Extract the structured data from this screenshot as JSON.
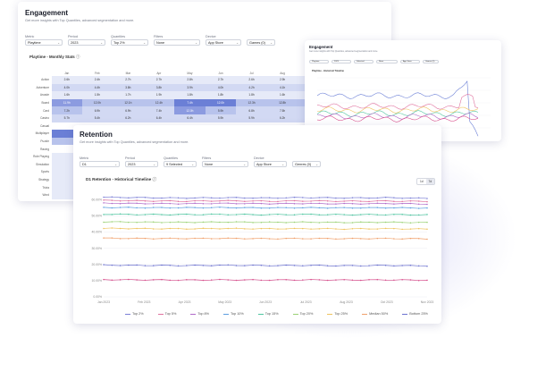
{
  "engagement": {
    "title": "Engagement",
    "subtitle": "Get more insights with Top Quantiles, advanced segmentation and more.",
    "filters": [
      {
        "label": "Metric",
        "value": "Playtime"
      },
      {
        "label": "Period",
        "value": "2023"
      },
      {
        "label": "Quantiles",
        "value": "Top 2%"
      },
      {
        "label": "Filters",
        "value": "None"
      },
      {
        "label": "Device",
        "value": "App Store"
      },
      {
        "label": "",
        "value": "Games (0)"
      }
    ],
    "table_title": "Playtime - Monthly Stats",
    "months": [
      "Jan",
      "Feb",
      "Mar",
      "Apr",
      "May",
      "Jun",
      "Jul",
      "Aug",
      "Sep"
    ],
    "rows": [
      {
        "genre": "Action",
        "cells": [
          "2.6h",
          "2.4h",
          "2.7h",
          "2.7h",
          "2.8h",
          "2.7h",
          "2.6h",
          "2.9h",
          "2.7h"
        ]
      },
      {
        "genre": "Adventure",
        "cells": [
          "4.0h",
          "4.4h",
          "3.8h",
          "3.8h",
          "3.9h",
          "4.0h",
          "4.2h",
          "4.1h",
          "4.0h"
        ]
      },
      {
        "genre": "Arcade",
        "cells": [
          "1.6h",
          "1.5h",
          "1.7h",
          "1.9h",
          "1.8h",
          "1.8h",
          "1.8h",
          "1.6h",
          "1.7h"
        ]
      },
      {
        "genre": "Board",
        "cells": [
          "11.9h",
          "12.0h",
          "12.1h",
          "12.4h",
          "7.4h",
          "12.0h",
          "12.3h",
          "12.8h",
          "12.4h"
        ]
      },
      {
        "genre": "Card",
        "cells": [
          "7.2h",
          "6.9h",
          "6.9h",
          "7.4h",
          "12.0h",
          "5.9h",
          "6.8h",
          "7.5h",
          "7.4h"
        ]
      },
      {
        "genre": "Casino",
        "cells": [
          "5.7h",
          "5.4h",
          "6.2h",
          "6.4h",
          "6.4h",
          "5.9h",
          "5.9h",
          "6.2h",
          "6.7h"
        ]
      },
      {
        "genre": "Casual",
        "cells": [
          "",
          "",
          "",
          "",
          "",
          "",
          "",
          "",
          ""
        ]
      },
      {
        "genre": "Multiplayer",
        "cells": [
          "",
          "",
          "",
          "",
          "",
          "",
          "",
          "",
          ""
        ]
      },
      {
        "genre": "Puzzle",
        "cells": [
          "",
          "",
          "",
          "",
          "",
          "",
          "",
          "",
          ""
        ]
      },
      {
        "genre": "Racing",
        "cells": [
          "",
          "",
          "",
          "",
          "",
          "",
          "",
          "",
          ""
        ]
      },
      {
        "genre": "Role Playing",
        "cells": [
          "",
          "",
          "",
          "",
          "",
          "",
          "",
          "",
          ""
        ]
      },
      {
        "genre": "Simulation",
        "cells": [
          "",
          "",
          "",
          "",
          "",
          "",
          "",
          "",
          ""
        ]
      },
      {
        "genre": "Sports",
        "cells": [
          "",
          "",
          "",
          "",
          "",
          "",
          "",
          "",
          ""
        ]
      },
      {
        "genre": "Strategy",
        "cells": [
          "",
          "",
          "",
          "",
          "",
          "",
          "",
          "",
          ""
        ]
      },
      {
        "genre": "Trivia",
        "cells": [
          "",
          "",
          "",
          "",
          "",
          "",
          "",
          "",
          ""
        ]
      },
      {
        "genre": "Word",
        "cells": [
          "",
          "",
          "",
          "",
          "",
          "",
          "",
          "",
          ""
        ]
      }
    ],
    "heat_levels": [
      [
        1,
        1,
        1,
        1,
        1,
        1,
        1,
        1,
        1
      ],
      [
        2,
        2,
        2,
        2,
        2,
        2,
        2,
        2,
        2
      ],
      [
        1,
        1,
        1,
        1,
        1,
        1,
        1,
        1,
        1
      ],
      [
        4,
        3,
        3,
        3,
        5,
        5,
        3,
        3,
        3
      ],
      [
        3,
        2,
        2,
        2,
        4,
        3,
        2,
        2,
        2
      ],
      [
        2,
        2,
        2,
        2,
        2,
        2,
        2,
        2,
        2
      ],
      [
        0,
        0,
        0,
        0,
        0,
        0,
        0,
        0,
        0
      ],
      [
        5,
        0,
        0,
        0,
        0,
        0,
        0,
        0,
        0
      ],
      [
        3,
        0,
        0,
        0,
        0,
        0,
        0,
        0,
        0
      ],
      [
        0,
        0,
        0,
        0,
        0,
        0,
        0,
        0,
        0
      ],
      [
        1,
        0,
        0,
        0,
        0,
        0,
        0,
        0,
        0
      ],
      [
        1,
        0,
        0,
        0,
        0,
        0,
        0,
        0,
        0
      ],
      [
        1,
        0,
        0,
        0,
        0,
        0,
        0,
        0,
        0
      ],
      [
        1,
        0,
        0,
        0,
        0,
        0,
        0,
        0,
        0
      ],
      [
        1,
        0,
        0,
        0,
        0,
        0,
        0,
        0,
        0
      ],
      [
        1,
        0,
        0,
        0,
        0,
        0,
        0,
        0,
        0
      ]
    ]
  },
  "popup": {
    "title": "Engagement",
    "subtitle": "Get more insights with Top Quantiles, advanced segmentation and more.",
    "filters": [
      "Playtime",
      "2023",
      "Selected",
      "None",
      "App Store",
      "Games (0)"
    ],
    "chart_title": "Playtime - Historical Timeline"
  },
  "retention": {
    "title": "Retention",
    "subtitle": "Get more insights with Top Quantiles, advanced segmentation and more.",
    "filters": [
      {
        "label": "Metric",
        "value": "D1"
      },
      {
        "label": "Period",
        "value": "2023"
      },
      {
        "label": "Quantiles",
        "value": "9 Selected"
      },
      {
        "label": "Filters",
        "value": "None"
      },
      {
        "label": "Device",
        "value": "App Store"
      },
      {
        "label": "",
        "value": "Genres (0)"
      }
    ],
    "chart_title": "D1 Retention - Historical Timeline",
    "toggle": [
      "1d",
      "7d"
    ]
  },
  "chart_data": [
    {
      "type": "line",
      "title": "D1 Retention - Historical Timeline",
      "x": [
        "Jan 2023",
        "Feb 2023",
        "Apr 2023",
        "May 2023",
        "Jun 2023",
        "Jul 2023",
        "Aug 2023",
        "Oct 2023",
        "Nov 2023"
      ],
      "y_ticks": [
        "0.00%",
        "10.00%",
        "20.00%",
        "30.00%",
        "40.00%",
        "50.00%",
        "60.00%"
      ],
      "ylim": [
        0,
        60
      ],
      "series": [
        {
          "name": "Top 2%",
          "color": "#7b7fd6",
          "values": [
            61.5,
            61.2,
            61.0,
            61.2,
            61.0,
            61.3,
            61.0,
            61.2,
            60.8
          ]
        },
        {
          "name": "Top 5%",
          "color": "#e0729f",
          "values": [
            59.5,
            59.2,
            59.0,
            59.3,
            59.0,
            59.2,
            59.0,
            59.1,
            58.9
          ]
        },
        {
          "name": "Top 8%",
          "color": "#b06ac9",
          "values": [
            57.8,
            57.6,
            57.5,
            57.7,
            57.5,
            57.6,
            57.4,
            57.6,
            57.3
          ]
        },
        {
          "name": "Top 10%",
          "color": "#5d9ee0",
          "values": [
            55.2,
            55.0,
            55.0,
            55.1,
            54.9,
            55.0,
            54.9,
            55.0,
            54.8
          ]
        },
        {
          "name": "Top 15%",
          "color": "#4fc5a0",
          "values": [
            51.0,
            50.8,
            50.8,
            50.9,
            50.7,
            50.9,
            50.7,
            50.8,
            50.6
          ]
        },
        {
          "name": "Top 20%",
          "color": "#9ad174",
          "values": [
            46.3,
            46.1,
            46.0,
            46.2,
            46.0,
            46.1,
            45.9,
            46.1,
            45.8
          ]
        },
        {
          "name": "Top 25%",
          "color": "#efc35e",
          "values": [
            42.3,
            42.1,
            42.0,
            42.2,
            42.0,
            42.1,
            41.9,
            42.1,
            41.8
          ]
        },
        {
          "name": "Median 50%",
          "color": "#f0a06b",
          "values": [
            36.2,
            36.0,
            36.0,
            36.1,
            35.9,
            36.0,
            35.9,
            36.0,
            35.8
          ]
        },
        {
          "name": "Bottom 25%",
          "color": "#6c72cf",
          "values": [
            19.6,
            19.4,
            19.3,
            19.5,
            19.3,
            19.4,
            19.2,
            19.4,
            19.1
          ]
        },
        {
          "name": "",
          "color": "#d94f8c",
          "values": [
            10.6,
            10.5,
            10.4,
            10.5,
            10.4,
            10.5,
            10.4,
            10.5,
            10.3
          ]
        }
      ]
    }
  ]
}
